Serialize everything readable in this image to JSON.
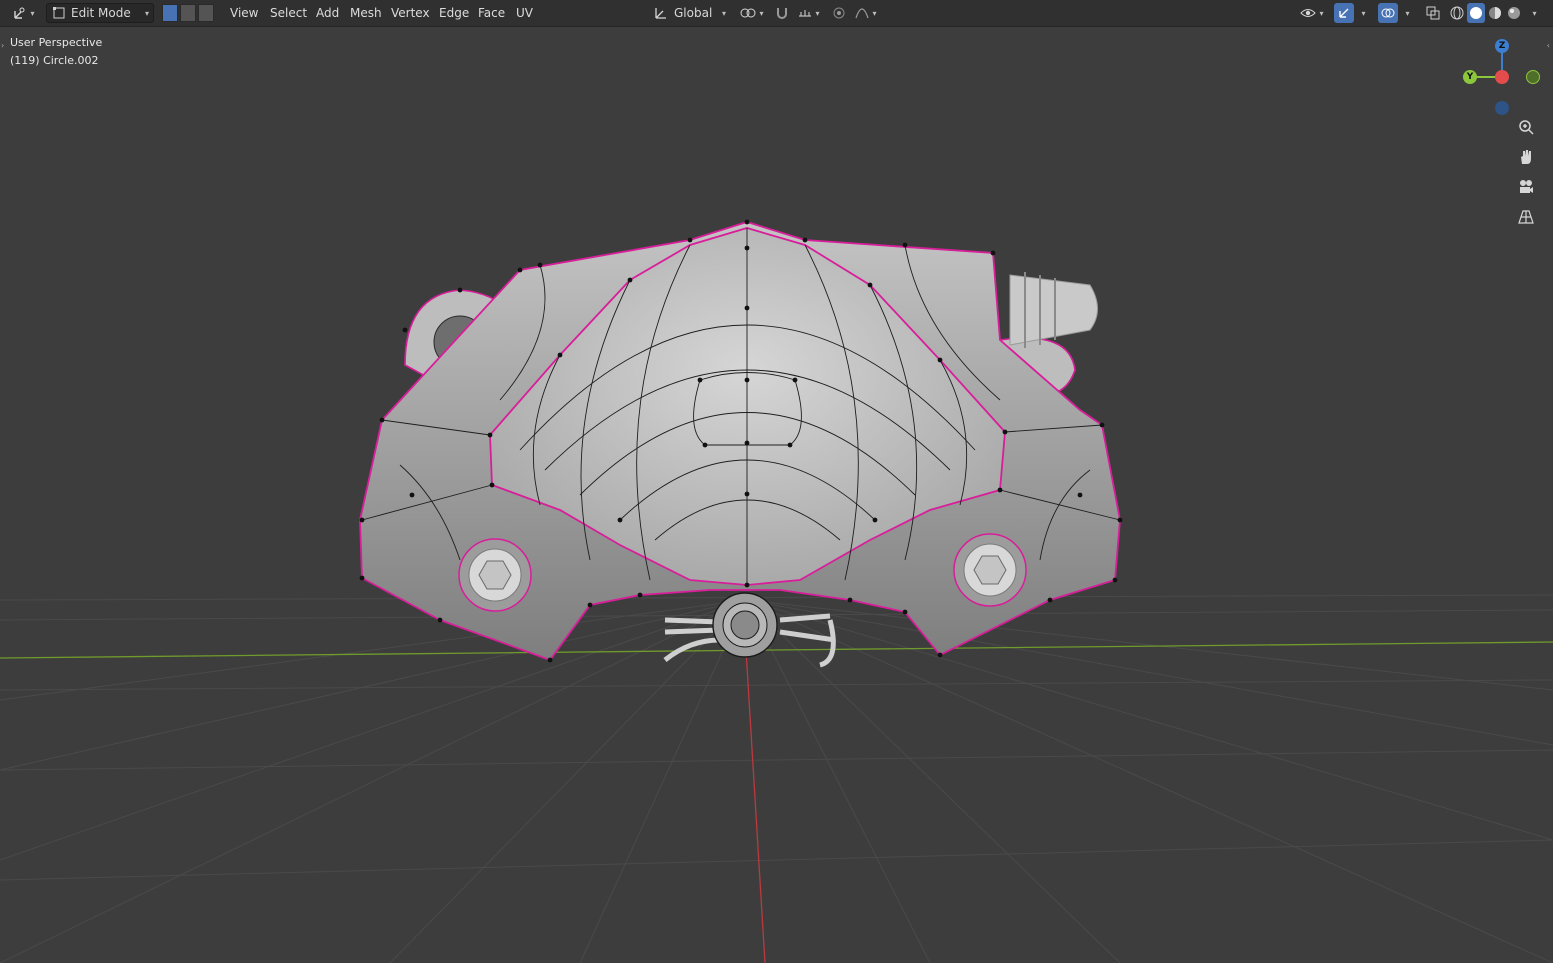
{
  "header": {
    "mode_label": "Edit Mode",
    "menus": [
      "View",
      "Select",
      "Add",
      "Mesh",
      "Vertex",
      "Edge",
      "Face",
      "UV"
    ],
    "transform_orientation": "Global",
    "select_modes": [
      "vertex",
      "edge",
      "face"
    ],
    "active_select_mode": "vertex",
    "icons": {
      "editor_type": "transform-gizmo-icon",
      "mode": "edit-mode-icon",
      "orientation": "orientation-axes-icon",
      "pivot": "pivot-point-icon",
      "snap": "snap-magnet-icon",
      "snap_target": "snap-increment-icon",
      "proportional": "proportional-edit-icon",
      "falloff": "falloff-curve-icon",
      "visibility": "eye-icon",
      "gizmos": "gizmo-icon",
      "overlays": "overlays-icon",
      "xray": "xray-icon",
      "shading": [
        "wireframe-shading-icon",
        "solid-shading-icon",
        "material-shading-icon",
        "rendered-shading-icon"
      ]
    },
    "active_shading": "solid"
  },
  "viewport": {
    "view_name": "User Perspective",
    "object_info": "(119) Circle.002",
    "gizmo_axes": {
      "z": "Z",
      "y": "Y"
    },
    "nav_buttons": [
      "zoom-icon",
      "hand-pan-icon",
      "camera-icon",
      "grid-perspective-icon"
    ],
    "colors": {
      "background": "#3d3d3d",
      "grid": "#4a4a4a",
      "x_axis": "#b93a3f",
      "y_axis": "#6f9a2c",
      "selection": "#d81e9a",
      "mesh": "#c6c6c6",
      "gizmo_x": "#e44c4c",
      "gizmo_y": "#8bc63b",
      "gizmo_z": "#3b7ed2"
    }
  }
}
